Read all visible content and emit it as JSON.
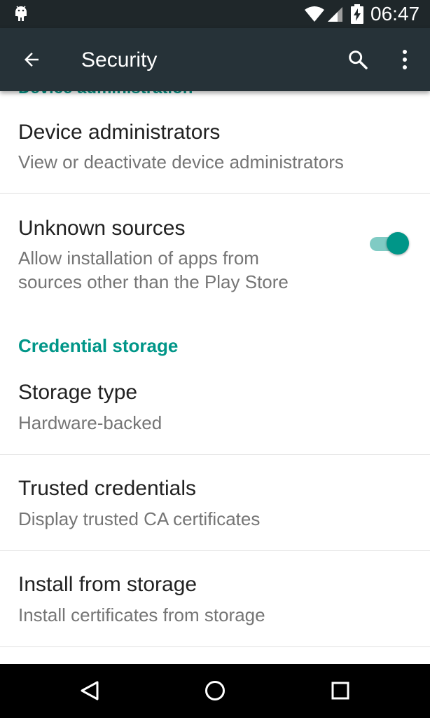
{
  "status_bar": {
    "time": "06:47",
    "icons": [
      "android-icon",
      "wifi-icon",
      "signal-icon",
      "battery-charging-icon"
    ]
  },
  "app_bar": {
    "title": "Security",
    "icons": [
      "back-arrow-icon",
      "search-icon",
      "more-vert-icon"
    ]
  },
  "content": {
    "clipped_header": "Device administration",
    "items": [
      {
        "title": "Device administrators",
        "summary": "View or deactivate device administrators"
      },
      {
        "title": "Unknown sources",
        "summary_line1": "Allow installation of apps from",
        "summary_line2": "sources other than the Play Store",
        "toggle_on": true
      }
    ],
    "category": "Credential storage",
    "credential_items": [
      {
        "title": "Storage type",
        "summary": "Hardware-backed"
      },
      {
        "title": "Trusted credentials",
        "summary": "Display trusted CA certificates"
      },
      {
        "title": "Install from storage",
        "summary": "Install certificates from storage"
      }
    ]
  },
  "nav_bar": {
    "icons": [
      "back-triangle-icon",
      "home-circle-icon",
      "recents-square-icon"
    ]
  },
  "colors": {
    "accent": "#009688",
    "app_bar": "#263238",
    "status_bar": "#1f272a"
  }
}
